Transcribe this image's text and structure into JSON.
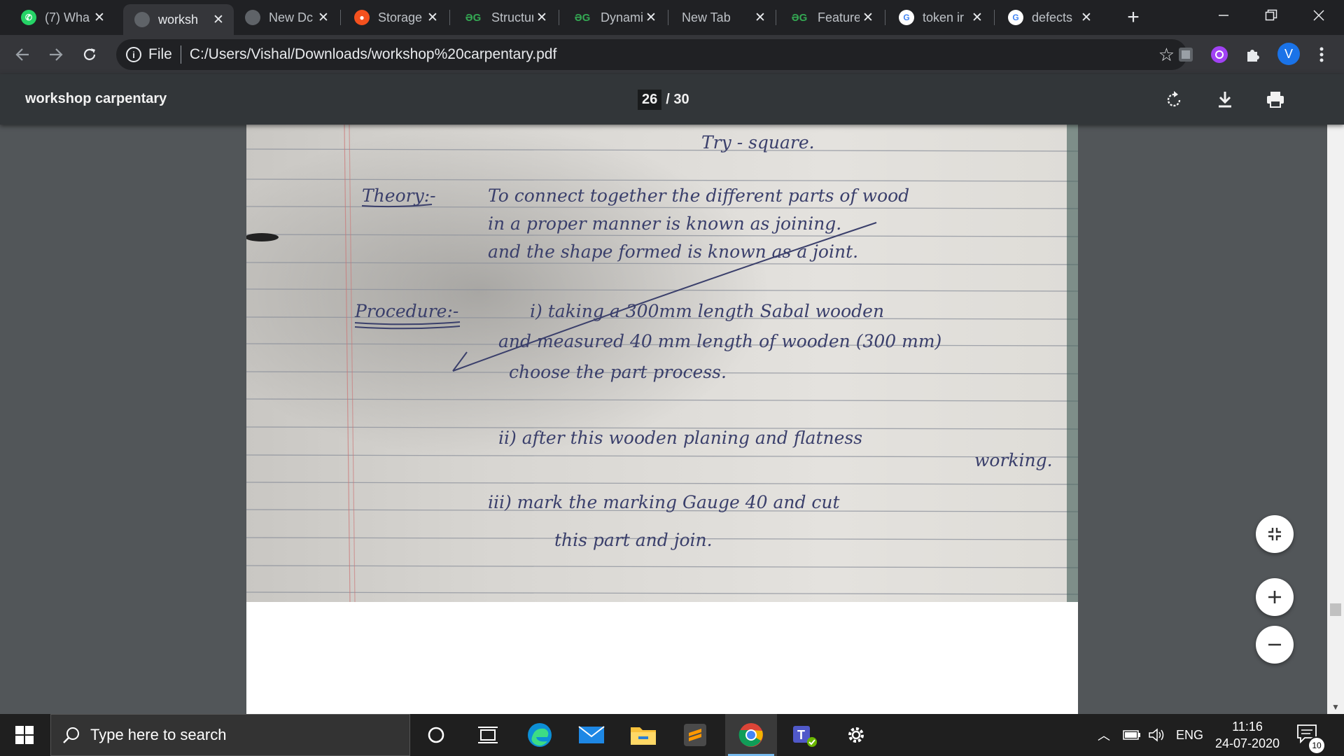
{
  "tabs": [
    {
      "title": "(7) Wha",
      "icon": "whatsapp-icon",
      "color": "#25d366",
      "active": false
    },
    {
      "title": "worksh",
      "icon": "globe-icon",
      "color": "#9aa0a6",
      "active": true
    },
    {
      "title": "New Dc",
      "icon": "globe-icon",
      "color": "#9aa0a6",
      "active": false
    },
    {
      "title": "Storage",
      "icon": "storage-icon",
      "color": "#f4511e",
      "active": false
    },
    {
      "title": "Structur",
      "icon": "dg-icon",
      "color": "#34a853",
      "active": false
    },
    {
      "title": "Dynami",
      "icon": "dg-icon",
      "color": "#34a853",
      "active": false
    },
    {
      "title": "New Tab",
      "icon": "none",
      "color": "",
      "active": false
    },
    {
      "title": "Feature",
      "icon": "dg-icon",
      "color": "#34a853",
      "active": false
    },
    {
      "title": "token ir",
      "icon": "google-icon",
      "color": "#4285f4",
      "active": false
    },
    {
      "title": "defects",
      "icon": "google-icon",
      "color": "#4285f4",
      "active": false
    }
  ],
  "address": {
    "scheme": "File",
    "url": "C:/Users/Vishal/Downloads/workshop%20carpentary.pdf"
  },
  "profile_initial": "V",
  "pdf": {
    "title": "workshop carpentary",
    "page_current": "26",
    "page_total": "/ 30"
  },
  "notes": {
    "heading": "Try - square.",
    "theory_label": "Theory:-",
    "theory_lines": [
      "To connect together the different parts of wood",
      "in a proper manner is known as joining.",
      "and the shape formed is known as a joint."
    ],
    "procedure_label": "Procedure:-",
    "procedure_lines": [
      "i) taking a 300mm length Sabal wooden",
      "and measured 40 mm length of wooden (300 mm)",
      "choose the part process."
    ],
    "step2_lines": [
      "ii) after this wooden planing  and flatness",
      "working."
    ],
    "step3_lines": [
      "iii) mark the marking Gauge 40 and cut",
      "this part and join."
    ]
  },
  "taskbar": {
    "search_placeholder": "Type here to search",
    "lang": "ENG",
    "time": "11:16",
    "date": "24-07-2020",
    "notification_count": "10"
  }
}
